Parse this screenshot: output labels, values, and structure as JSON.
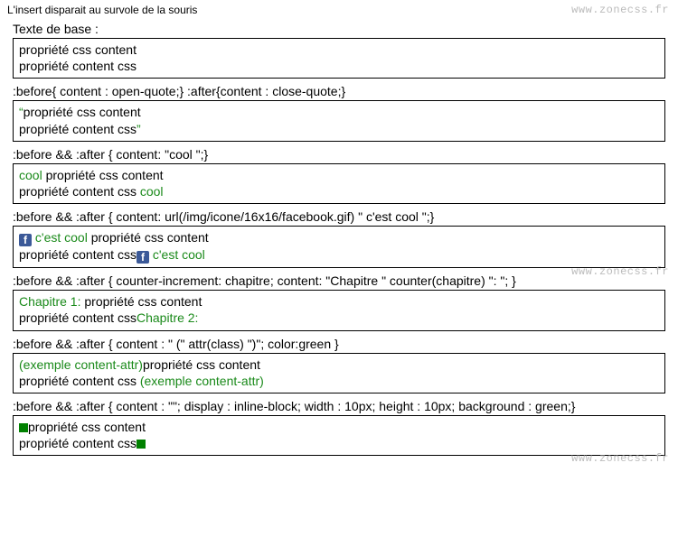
{
  "topnote": "L'insert disparait au survole de la souris",
  "watermark": "www.zonecss.fr",
  "base_text_line1": "propriété css content",
  "base_text_line2": "propriété content css",
  "sections": {
    "s0": {
      "label": "Texte de base :"
    },
    "s1": {
      "label": ":before{ content : open-quote;} :after{content : close-quote;}",
      "open_quote": "“",
      "close_quote": "”"
    },
    "s2": {
      "label": ":before && :after { content: \"cool \";}",
      "insert": "cool"
    },
    "s3": {
      "label": ":before && :after { content: url(/img/icone/16x16/facebook.gif) \" c'est cool \";}",
      "insert": " c'est cool",
      "icon_letter": "f"
    },
    "s4": {
      "label": ":before && :after { counter-increment: chapitre; content: \"Chapitre \" counter(chapitre) \": \"; }",
      "counter_before": "Chapitre 1:",
      "counter_after": "Chapitre 2:"
    },
    "s5": {
      "label": ":before && :after { content : \" (\" attr(class) \")\"; color:green }",
      "attr_text": "(exemple content-attr)"
    },
    "s6": {
      "label": ":before && :after { content : \"\"; display : inline-block; width : 10px; height : 10px; background : green;}"
    }
  }
}
